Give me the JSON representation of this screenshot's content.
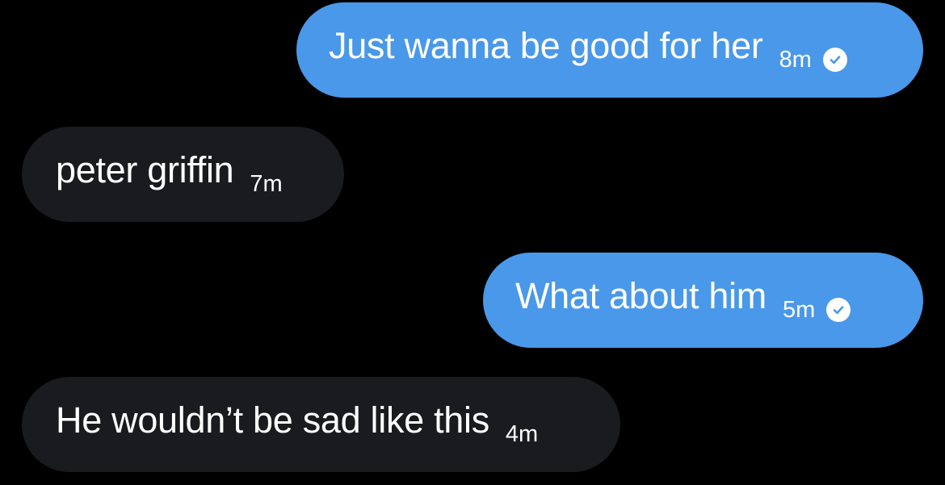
{
  "conversation": {
    "messages": [
      {
        "direction": "sent",
        "text": "Just wanna be good for her",
        "time": "8m",
        "status_icon": "read-check-icon"
      },
      {
        "direction": "received",
        "text": "peter griffin",
        "time": "7m"
      },
      {
        "direction": "sent",
        "text": "What about him",
        "time": "5m",
        "status_icon": "read-check-icon"
      },
      {
        "direction": "received",
        "text": "He wouldn’t be sad like this",
        "time": "4m"
      }
    ]
  },
  "colors": {
    "background": "#000000",
    "sent_bubble": "#4a98e9",
    "received_bubble": "#1a1b1e",
    "text": "#ffffff"
  }
}
